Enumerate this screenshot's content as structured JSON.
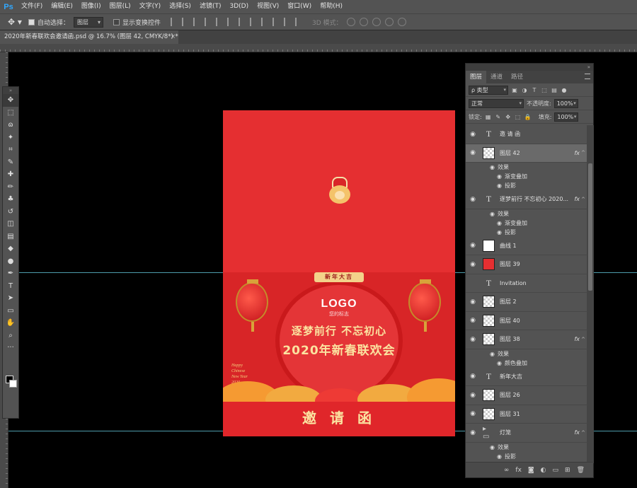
{
  "app": {
    "logo": "Ps"
  },
  "menu": [
    "文件(F)",
    "编辑(E)",
    "图像(I)",
    "图层(L)",
    "文字(Y)",
    "选择(S)",
    "滤镜(T)",
    "3D(D)",
    "视图(V)",
    "窗口(W)",
    "帮助(H)"
  ],
  "options": {
    "auto_select_label": "自动选择：",
    "auto_select_value": "图层",
    "show_transform_label": "显示变换控件",
    "mode3d_label": "3D 模式："
  },
  "document": {
    "tab_title": "2020年新春联欢会邀请函.psd @ 16.7% (图层 42, CMYK/8*) *",
    "tab_close": "×",
    "banner": "新年大吉",
    "logo": "LOGO",
    "logo_sub": "您的标志",
    "slogan1": "逐梦前行 不忘初心",
    "slogan2": "2020年新春联欢会",
    "happy_lines": [
      "Happy",
      "Chinese",
      "New Year",
      "2020"
    ],
    "invite": "邀 请 函"
  },
  "toolbar": {
    "grip": "»",
    "tools": [
      "move-tool-icon",
      "marquee-tool-icon",
      "lasso-tool-icon",
      "magic-wand-tool-icon",
      "crop-tool-icon",
      "eyedropper-tool-icon",
      "healing-tool-icon",
      "brush-tool-icon",
      "clone-stamp-tool-icon",
      "history-brush-tool-icon",
      "eraser-tool-icon",
      "gradient-tool-icon",
      "blur-tool-icon",
      "dodge-tool-icon",
      "pen-tool-icon",
      "type-tool-icon",
      "path-select-tool-icon",
      "rectangle-tool-icon",
      "hand-tool-icon",
      "zoom-tool-icon",
      "more-tools-icon"
    ],
    "glyphs": [
      "✥",
      "⬚",
      "ɷ",
      "✦",
      "⌗",
      "✎",
      "✚",
      "✏",
      "♣",
      "↺",
      "◫",
      "▤",
      "◆",
      "●",
      "✒",
      "T",
      "➤",
      "▭",
      "✋",
      "⌕",
      "···"
    ]
  },
  "layers_panel": {
    "collapse": "»",
    "tabs": [
      "图层",
      "通道",
      "路径"
    ],
    "filter_label": "ρ 类型",
    "blend_mode": "正常",
    "opacity_label": "不透明度:",
    "opacity_value": "100%",
    "lock_label": "锁定:",
    "fill_label": "填充:",
    "fill_value": "100%",
    "eye_glyph": "◉",
    "fx": "fx",
    "layers": [
      {
        "name": "邀 请 函",
        "thumb": "type",
        "visible": true,
        "fx": false
      },
      {
        "name": "图层 42",
        "thumb": "trans",
        "visible": true,
        "fx": true,
        "selected": true,
        "effects": [
          "效果",
          "渐变叠加",
          "投影"
        ]
      },
      {
        "name": "逐梦前行 不忘初心 2020...",
        "thumb": "type",
        "visible": true,
        "fx": true,
        "effects": [
          "效果",
          "渐变叠加",
          "投影"
        ]
      },
      {
        "name": "曲线 1",
        "thumb": "white",
        "visible": true,
        "fx": false
      },
      {
        "name": "图层 39",
        "thumb": "red",
        "visible": true,
        "fx": false
      },
      {
        "name": "Invitation",
        "thumb": "type",
        "visible": false,
        "fx": false
      },
      {
        "name": "图层 2",
        "thumb": "trans",
        "visible": true,
        "fx": false
      },
      {
        "name": "图层 40",
        "thumb": "trans",
        "visible": true,
        "fx": false
      },
      {
        "name": "图层 38",
        "thumb": "trans",
        "visible": true,
        "fx": true,
        "effects": [
          "效果",
          "颜色叠加"
        ]
      },
      {
        "name": "新年大吉",
        "thumb": "type",
        "visible": true,
        "fx": false
      },
      {
        "name": "图层 26",
        "thumb": "trans",
        "visible": true,
        "fx": false
      },
      {
        "name": "图层 31",
        "thumb": "trans",
        "visible": true,
        "fx": false
      },
      {
        "name": "灯笼",
        "thumb": "folder",
        "visible": true,
        "fx": true,
        "effects": [
          "效果",
          "投影"
        ]
      }
    ],
    "footer_icons": [
      "link-icon",
      "fx-icon",
      "mask-icon",
      "adjustment-icon",
      "folder-icon",
      "new-layer-icon",
      "trash-icon"
    ],
    "footer_glyphs": [
      "∞",
      "fx",
      "◙",
      "◐",
      "▭",
      "⊞",
      "🗑"
    ]
  },
  "colors": {
    "accent": "#31a8ff",
    "doc_red": "#e52f31",
    "gold": "#fbe3a0",
    "guide": "#5ab7c9"
  }
}
